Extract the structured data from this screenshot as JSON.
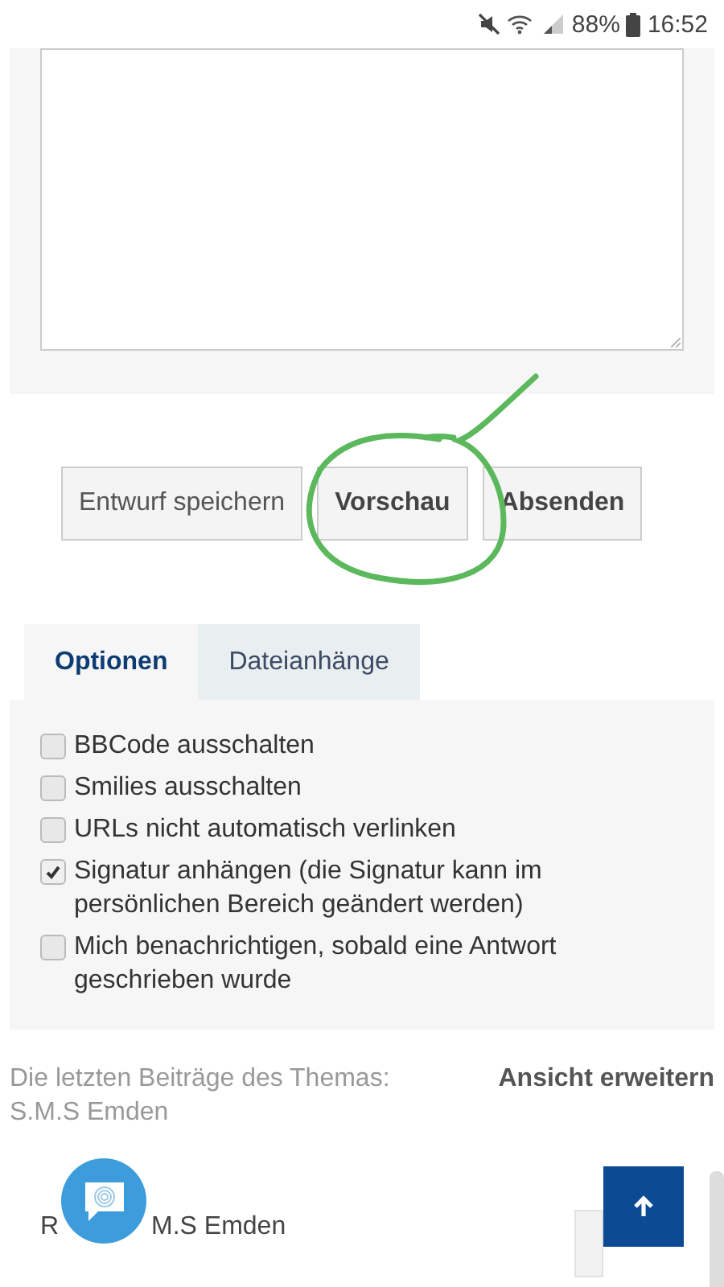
{
  "status_bar": {
    "battery": "88%",
    "time": "16:52"
  },
  "buttons": [
    {
      "label": "Entwurf speichern"
    },
    {
      "label": "Vorschau"
    },
    {
      "label": "Absenden"
    }
  ],
  "tabs": [
    {
      "label": "Optionen",
      "selected": true
    },
    {
      "label": "Dateianhänge",
      "selected": false
    }
  ],
  "options": [
    {
      "label": "BBCode ausschalten",
      "checked": false
    },
    {
      "label": "Smilies ausschalten",
      "checked": false
    },
    {
      "label": "URLs nicht automatisch verlinken",
      "checked": false
    },
    {
      "label": "Signatur anhängen (die Signatur kann im persönlichen Bereich geändert werden)",
      "checked": true
    },
    {
      "label": "Mich benachrichtigen, sobald eine Antwort geschrieben wurde",
      "checked": false
    }
  ],
  "recent": {
    "heading": "Die letzten Beiträge des Themas: S.M.S Emden",
    "expand_link": "Ansicht erweitern",
    "post_title_parts": [
      "R",
      "M.S Emden"
    ]
  }
}
